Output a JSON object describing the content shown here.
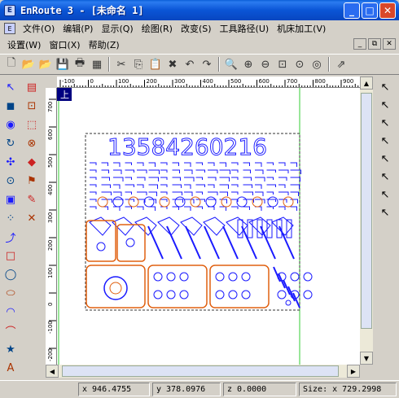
{
  "window": {
    "app_icon_text": "E",
    "title": "EnRoute 3 - [未命名 1]",
    "min": "_",
    "max": "□",
    "close": "✕"
  },
  "menu": {
    "icon_text": "E",
    "row1": [
      "文件(O)",
      "编辑(P)",
      "显示(Q)",
      "绘图(R)",
      "改变(S)",
      "工具路径(U)",
      "机床加工(V)"
    ],
    "row2": [
      "设置(W)",
      "窗口(X)",
      "帮助(Z)"
    ],
    "mdi_min": "_",
    "mdi_restore": "⧉",
    "mdi_close": "✕"
  },
  "toolbar": {
    "icons": [
      "new-file-icon",
      "open-folder-icon",
      "open-template-icon",
      "save-icon",
      "print-icon",
      "grid-icon",
      "sep",
      "cut-icon",
      "copy-icon",
      "paste-icon",
      "delete-icon",
      "undo-icon",
      "redo-icon",
      "sep",
      "zoom-window-icon",
      "zoom-in-icon",
      "zoom-out-icon",
      "zoom-fit-icon",
      "zoom-selected-icon",
      "zoom-prev-icon",
      "sep",
      "export-icon"
    ],
    "glyphs": [
      "🗋",
      "📂",
      "📂",
      "💾",
      "🖶",
      "▦",
      "",
      "✂",
      "⎘",
      "📋",
      "✖",
      "↶",
      "↷",
      "",
      "🔍",
      "⊕",
      "⊖",
      "⊡",
      "⊙",
      "◎",
      "",
      "⇗"
    ]
  },
  "left_tools": {
    "icons": [
      "select-arrow-icon",
      "layers-icon",
      "node-edit-icon",
      "rotate-icon",
      "circle-shapes-icon",
      "rect-frame-icon",
      "align-icon",
      "flip-icon",
      "transform-icon",
      "weld-icon",
      "array-icon",
      "measure-icon",
      "contour-icon",
      "fill-icon",
      "grid-dots-icon",
      "trim-icon",
      "bezier-icon",
      "rectangle-icon",
      "circle-icon",
      "ellipse-icon",
      "arc-icon",
      "polyline-icon",
      "star-icon",
      "text-icon"
    ],
    "glyphs": [
      "↖",
      "▤",
      "◼",
      "⊡",
      "◉",
      "⬚",
      "↻",
      "⊗",
      "✣",
      "◆",
      "⊙",
      "⚑",
      "▣",
      "✎",
      "⁘",
      "✕",
      "⤴",
      "□",
      "◯",
      "⬭",
      "◠",
      "⌒",
      "★",
      "A"
    ]
  },
  "right_tools": {
    "icons": [
      "arrow-1-icon",
      "arrow-2-icon",
      "arrow-3-icon",
      "arrow-4-icon",
      "arrow-5-icon",
      "arrow-6-icon",
      "arrow-7-icon",
      "arrow-8-icon"
    ],
    "glyphs": [
      "↖",
      "↖",
      "↖",
      "↖",
      "↖",
      "↖",
      "↖",
      "↖"
    ]
  },
  "rulers": {
    "top_labels": [
      "-100",
      "0",
      "100",
      "200",
      "300",
      "400",
      "500",
      "600",
      "700",
      "800",
      "900"
    ],
    "left_labels": [
      "700",
      "600",
      "500",
      "400",
      "300",
      "200",
      "100",
      "0",
      "-100",
      "-200"
    ]
  },
  "canvas": {
    "view_label": "上",
    "drawing_text": "13584260216",
    "accent_blue": "#1a1aff",
    "accent_orange": "#e06010",
    "page_border": "#33cc33"
  },
  "status": {
    "x": "x 946.4755",
    "y": "y 378.0976",
    "z": "z 0.0000",
    "size": "Size: x 729.2998"
  }
}
